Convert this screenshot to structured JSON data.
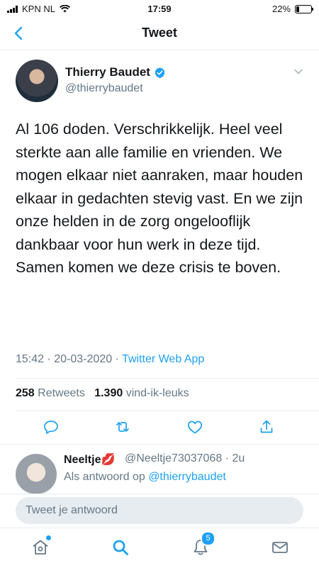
{
  "status_bar": {
    "carrier": "KPN NL",
    "time": "17:59",
    "battery": "22%",
    "battery_level": 0.22
  },
  "nav": {
    "title": "Tweet"
  },
  "author": {
    "name": "Thierry Baudet",
    "handle": "@thierrybaudet",
    "verified": true
  },
  "tweet": {
    "text": "Al 106 doden. Verschrikkelijk. Heel veel sterkte aan alle familie en vrienden. We mogen elkaar niet aanraken, maar houden elkaar in gedachten stevig vast. En we zijn onze helden in de zorg ongelooflijk dankbaar voor hun werk in deze tijd. Samen komen we deze crisis te boven.",
    "time": "15:42",
    "sep1": " · ",
    "date": "20-03-2020",
    "sep2": " · ",
    "app": "Twitter Web App"
  },
  "stats": {
    "retweets_count": "258",
    "retweets_label": "Retweets",
    "likes_count": "1.390",
    "likes_label": "vind-ik-leuks"
  },
  "actions": {
    "icons": [
      "reply-icon",
      "retweet-icon",
      "like-icon",
      "share-icon"
    ]
  },
  "reply": {
    "name": "Neeltje",
    "emoji": "💋",
    "handle": "@Neeltje73037068",
    "age": " · 2u",
    "prefix": "Als antwoord op ",
    "mention": "@thierrybaudet"
  },
  "composer": {
    "placeholder": "Tweet je antwoord"
  },
  "tabbar": {
    "notifications_badge": "5"
  },
  "colors": {
    "accent": "#1da1f2",
    "text": "#14171a",
    "secondary": "#657786",
    "divider": "#e6ecf0"
  }
}
